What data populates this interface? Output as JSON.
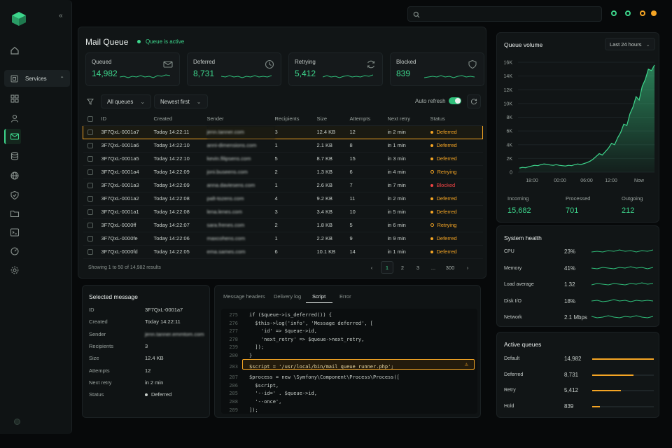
{
  "sidebar": {
    "services_label": "Services"
  },
  "main": {
    "title": "Mail Queue",
    "queue_status": "Queue is active",
    "stats": [
      {
        "label": "Queued",
        "value": "14,982",
        "icon": "mail-icon"
      },
      {
        "label": "Deferred",
        "value": "8,731",
        "icon": "clock-icon"
      },
      {
        "label": "Retrying",
        "value": "5,412",
        "icon": "refresh-icon"
      },
      {
        "label": "Blocked",
        "value": "839",
        "icon": "shield-icon"
      }
    ],
    "filter_queue": "All queues",
    "filter_sort": "Newest first",
    "auto_refresh_label": "Auto refresh",
    "table": {
      "headers": [
        "ID",
        "Created",
        "Sender",
        "Recipients",
        "Size",
        "Attempts",
        "Next retry",
        "Status"
      ],
      "rows": [
        {
          "id": "3F7QxL-0001a7",
          "created": "Today 14:22:11",
          "sender": "jenn.tanner.com",
          "recipients": "3",
          "size": "12.4 KB",
          "attempts": "12",
          "next_retry": "in 2 min",
          "status": "Deferred"
        },
        {
          "id": "3F7QxL-0001a6",
          "created": "Today 14:22:10",
          "sender": "anni-dimensions.com",
          "recipients": "1",
          "size": "2.1 KB",
          "attempts": "8",
          "next_retry": "in 1 min",
          "status": "Deferred"
        },
        {
          "id": "3F7QxL-0001a5",
          "created": "Today 14:22:10",
          "sender": "kevin.filipsens.com",
          "recipients": "5",
          "size": "8.7 KB",
          "attempts": "15",
          "next_retry": "in 3 min",
          "status": "Deferred"
        },
        {
          "id": "3F7QxL-0001a4",
          "created": "Today 14:22:09",
          "sender": "joni.buseens.com",
          "recipients": "2",
          "size": "1.3 KB",
          "attempts": "6",
          "next_retry": "in 4 min",
          "status": "Retrying"
        },
        {
          "id": "3F7QxL-0001a3",
          "created": "Today 14:22:09",
          "sender": "anna.daviesens.com",
          "recipients": "1",
          "size": "2.6 KB",
          "attempts": "7",
          "next_retry": "in 7 min",
          "status": "Blocked"
        },
        {
          "id": "3F7QxL-0001a2",
          "created": "Today 14:22:08",
          "sender": "palt-tozens.com",
          "recipients": "4",
          "size": "9.2 KB",
          "attempts": "11",
          "next_retry": "in 2 min",
          "status": "Deferred"
        },
        {
          "id": "3F7QxL-0001a1",
          "created": "Today 14:22:08",
          "sender": "lena.lenes.com",
          "recipients": "3",
          "size": "3.4 KB",
          "attempts": "10",
          "next_retry": "in 5 min",
          "status": "Deferred"
        },
        {
          "id": "3F7QxL-0000ff",
          "created": "Today 14:22:07",
          "sender": "sara.frenes.com",
          "recipients": "2",
          "size": "1.8 KB",
          "attempts": "5",
          "next_retry": "in 6 min",
          "status": "Retrying"
        },
        {
          "id": "3F7QxL-0000fe",
          "created": "Today 14:22:06",
          "sender": "maxcohens.com",
          "recipients": "1",
          "size": "2.2 KB",
          "attempts": "9",
          "next_retry": "in 9 min",
          "status": "Deferred"
        },
        {
          "id": "3F7QxL-0000fd",
          "created": "Today 14:22:05",
          "sender": "ema.sames.com",
          "recipients": "6",
          "size": "10.1 KB",
          "attempts": "14",
          "next_retry": "in 1 min",
          "status": "Deferred"
        }
      ]
    },
    "showing": "Showing 1 to 50 of 14,982 results",
    "pagination": [
      "‹",
      "1",
      "2",
      "3",
      "...",
      "300",
      "›"
    ]
  },
  "selected": {
    "title": "Selected message",
    "fields": [
      {
        "label": "ID",
        "value": "3F7QxL-0001a7"
      },
      {
        "label": "Created",
        "value": "Today 14:22:11"
      },
      {
        "label": "Sender",
        "value": "jenn.tanner.emmtom.com"
      },
      {
        "label": "Recipients",
        "value": "3"
      },
      {
        "label": "Size",
        "value": "12.4 KB"
      },
      {
        "label": "Attempts",
        "value": "12"
      },
      {
        "label": "Next retry",
        "value": "in 2 min"
      },
      {
        "label": "Status",
        "value": "Deferred"
      }
    ]
  },
  "code": {
    "tabs": [
      "Message headers",
      "Delivery log",
      "Script",
      "Error"
    ],
    "active_tab": "Script",
    "lines": [
      {
        "n": "275",
        "t": "if ($queue->is_deferred()) {"
      },
      {
        "n": "276",
        "t": "  $this->log('info', 'Message deferred', ["
      },
      {
        "n": "277",
        "t": "    'id' => $queue->id,"
      },
      {
        "n": "278",
        "t": "    'next_retry' => $queue->next_retry,"
      },
      {
        "n": "239",
        "t": "  ]);"
      },
      {
        "n": "280",
        "t": "}"
      },
      {
        "n": "283",
        "t": "$script = '/usr/local/bin/mail_queue_runner.php';"
      },
      {
        "n": "287",
        "t": "$process = new \\Symfony\\Component\\Process\\Process(["
      },
      {
        "n": "286",
        "t": "  $script,"
      },
      {
        "n": "285",
        "t": "  '--id=' . $queue->id,"
      },
      {
        "n": "288",
        "t": "  '--once',"
      },
      {
        "n": "289",
        "t": "]);"
      }
    ]
  },
  "volume": {
    "title": "Queue volume",
    "range": "Last 24 hours",
    "incoming_label": "Incoming",
    "incoming": "15,682",
    "processed_label": "Processed",
    "processed": "701",
    "outgoing_label": "Outgoing",
    "outgoing": "212",
    "chart_data": {
      "type": "area",
      "yticks": [
        "16K",
        "14K",
        "12K",
        "10K",
        "8K",
        "6K",
        "4K",
        "2K",
        "0"
      ],
      "xticks": [
        "18:00",
        "00:00",
        "06:00",
        "12:00",
        "Now"
      ],
      "ylim": [
        0,
        16000
      ],
      "values": [
        600,
        700,
        650,
        800,
        900,
        1000,
        950,
        1100,
        1200,
        1150,
        1050,
        1000,
        1100,
        1000,
        950,
        900,
        1000,
        950,
        1100,
        1200,
        1100,
        1250,
        1400,
        1600,
        1900,
        2300,
        2700,
        2500,
        3000,
        3500,
        4200,
        4000,
        5000,
        5800,
        7000,
        6800,
        8500,
        9500,
        11000,
        10500,
        12500,
        13500,
        15000,
        14800,
        15600
      ]
    }
  },
  "health": {
    "title": "System health",
    "items": [
      {
        "label": "CPU",
        "value": "23%"
      },
      {
        "label": "Memory",
        "value": "41%"
      },
      {
        "label": "Load average",
        "value": "1.32"
      },
      {
        "label": "Disk I/O",
        "value": "18%"
      },
      {
        "label": "Network",
        "value": "2.1 Mbps"
      }
    ]
  },
  "queues": {
    "title": "Active queues",
    "items": [
      {
        "label": "Default",
        "value": "14,982",
        "fill": 1.0
      },
      {
        "label": "Deferred",
        "value": "8,731",
        "fill": 0.67
      },
      {
        "label": "Retry",
        "value": "5,412",
        "fill": 0.47
      },
      {
        "label": "Hold",
        "value": "839",
        "fill": 0.12
      }
    ]
  },
  "colors": {
    "accent": "#3dd68c",
    "warning": "#f5a524",
    "danger": "#ef4444"
  }
}
